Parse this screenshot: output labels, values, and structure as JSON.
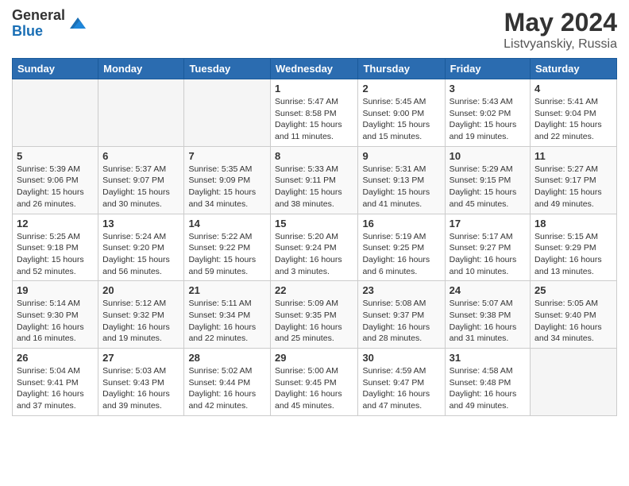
{
  "header": {
    "logo_general": "General",
    "logo_blue": "Blue",
    "month_year": "May 2024",
    "location": "Listvyanskiy, Russia"
  },
  "days_of_week": [
    "Sunday",
    "Monday",
    "Tuesday",
    "Wednesday",
    "Thursday",
    "Friday",
    "Saturday"
  ],
  "weeks": [
    [
      {
        "day": "",
        "info": ""
      },
      {
        "day": "",
        "info": ""
      },
      {
        "day": "",
        "info": ""
      },
      {
        "day": "1",
        "info": "Sunrise: 5:47 AM\nSunset: 8:58 PM\nDaylight: 15 hours\nand 11 minutes."
      },
      {
        "day": "2",
        "info": "Sunrise: 5:45 AM\nSunset: 9:00 PM\nDaylight: 15 hours\nand 15 minutes."
      },
      {
        "day": "3",
        "info": "Sunrise: 5:43 AM\nSunset: 9:02 PM\nDaylight: 15 hours\nand 19 minutes."
      },
      {
        "day": "4",
        "info": "Sunrise: 5:41 AM\nSunset: 9:04 PM\nDaylight: 15 hours\nand 22 minutes."
      }
    ],
    [
      {
        "day": "5",
        "info": "Sunrise: 5:39 AM\nSunset: 9:06 PM\nDaylight: 15 hours\nand 26 minutes."
      },
      {
        "day": "6",
        "info": "Sunrise: 5:37 AM\nSunset: 9:07 PM\nDaylight: 15 hours\nand 30 minutes."
      },
      {
        "day": "7",
        "info": "Sunrise: 5:35 AM\nSunset: 9:09 PM\nDaylight: 15 hours\nand 34 minutes."
      },
      {
        "day": "8",
        "info": "Sunrise: 5:33 AM\nSunset: 9:11 PM\nDaylight: 15 hours\nand 38 minutes."
      },
      {
        "day": "9",
        "info": "Sunrise: 5:31 AM\nSunset: 9:13 PM\nDaylight: 15 hours\nand 41 minutes."
      },
      {
        "day": "10",
        "info": "Sunrise: 5:29 AM\nSunset: 9:15 PM\nDaylight: 15 hours\nand 45 minutes."
      },
      {
        "day": "11",
        "info": "Sunrise: 5:27 AM\nSunset: 9:17 PM\nDaylight: 15 hours\nand 49 minutes."
      }
    ],
    [
      {
        "day": "12",
        "info": "Sunrise: 5:25 AM\nSunset: 9:18 PM\nDaylight: 15 hours\nand 52 minutes."
      },
      {
        "day": "13",
        "info": "Sunrise: 5:24 AM\nSunset: 9:20 PM\nDaylight: 15 hours\nand 56 minutes."
      },
      {
        "day": "14",
        "info": "Sunrise: 5:22 AM\nSunset: 9:22 PM\nDaylight: 15 hours\nand 59 minutes."
      },
      {
        "day": "15",
        "info": "Sunrise: 5:20 AM\nSunset: 9:24 PM\nDaylight: 16 hours\nand 3 minutes."
      },
      {
        "day": "16",
        "info": "Sunrise: 5:19 AM\nSunset: 9:25 PM\nDaylight: 16 hours\nand 6 minutes."
      },
      {
        "day": "17",
        "info": "Sunrise: 5:17 AM\nSunset: 9:27 PM\nDaylight: 16 hours\nand 10 minutes."
      },
      {
        "day": "18",
        "info": "Sunrise: 5:15 AM\nSunset: 9:29 PM\nDaylight: 16 hours\nand 13 minutes."
      }
    ],
    [
      {
        "day": "19",
        "info": "Sunrise: 5:14 AM\nSunset: 9:30 PM\nDaylight: 16 hours\nand 16 minutes."
      },
      {
        "day": "20",
        "info": "Sunrise: 5:12 AM\nSunset: 9:32 PM\nDaylight: 16 hours\nand 19 minutes."
      },
      {
        "day": "21",
        "info": "Sunrise: 5:11 AM\nSunset: 9:34 PM\nDaylight: 16 hours\nand 22 minutes."
      },
      {
        "day": "22",
        "info": "Sunrise: 5:09 AM\nSunset: 9:35 PM\nDaylight: 16 hours\nand 25 minutes."
      },
      {
        "day": "23",
        "info": "Sunrise: 5:08 AM\nSunset: 9:37 PM\nDaylight: 16 hours\nand 28 minutes."
      },
      {
        "day": "24",
        "info": "Sunrise: 5:07 AM\nSunset: 9:38 PM\nDaylight: 16 hours\nand 31 minutes."
      },
      {
        "day": "25",
        "info": "Sunrise: 5:05 AM\nSunset: 9:40 PM\nDaylight: 16 hours\nand 34 minutes."
      }
    ],
    [
      {
        "day": "26",
        "info": "Sunrise: 5:04 AM\nSunset: 9:41 PM\nDaylight: 16 hours\nand 37 minutes."
      },
      {
        "day": "27",
        "info": "Sunrise: 5:03 AM\nSunset: 9:43 PM\nDaylight: 16 hours\nand 39 minutes."
      },
      {
        "day": "28",
        "info": "Sunrise: 5:02 AM\nSunset: 9:44 PM\nDaylight: 16 hours\nand 42 minutes."
      },
      {
        "day": "29",
        "info": "Sunrise: 5:00 AM\nSunset: 9:45 PM\nDaylight: 16 hours\nand 45 minutes."
      },
      {
        "day": "30",
        "info": "Sunrise: 4:59 AM\nSunset: 9:47 PM\nDaylight: 16 hours\nand 47 minutes."
      },
      {
        "day": "31",
        "info": "Sunrise: 4:58 AM\nSunset: 9:48 PM\nDaylight: 16 hours\nand 49 minutes."
      },
      {
        "day": "",
        "info": ""
      }
    ]
  ]
}
